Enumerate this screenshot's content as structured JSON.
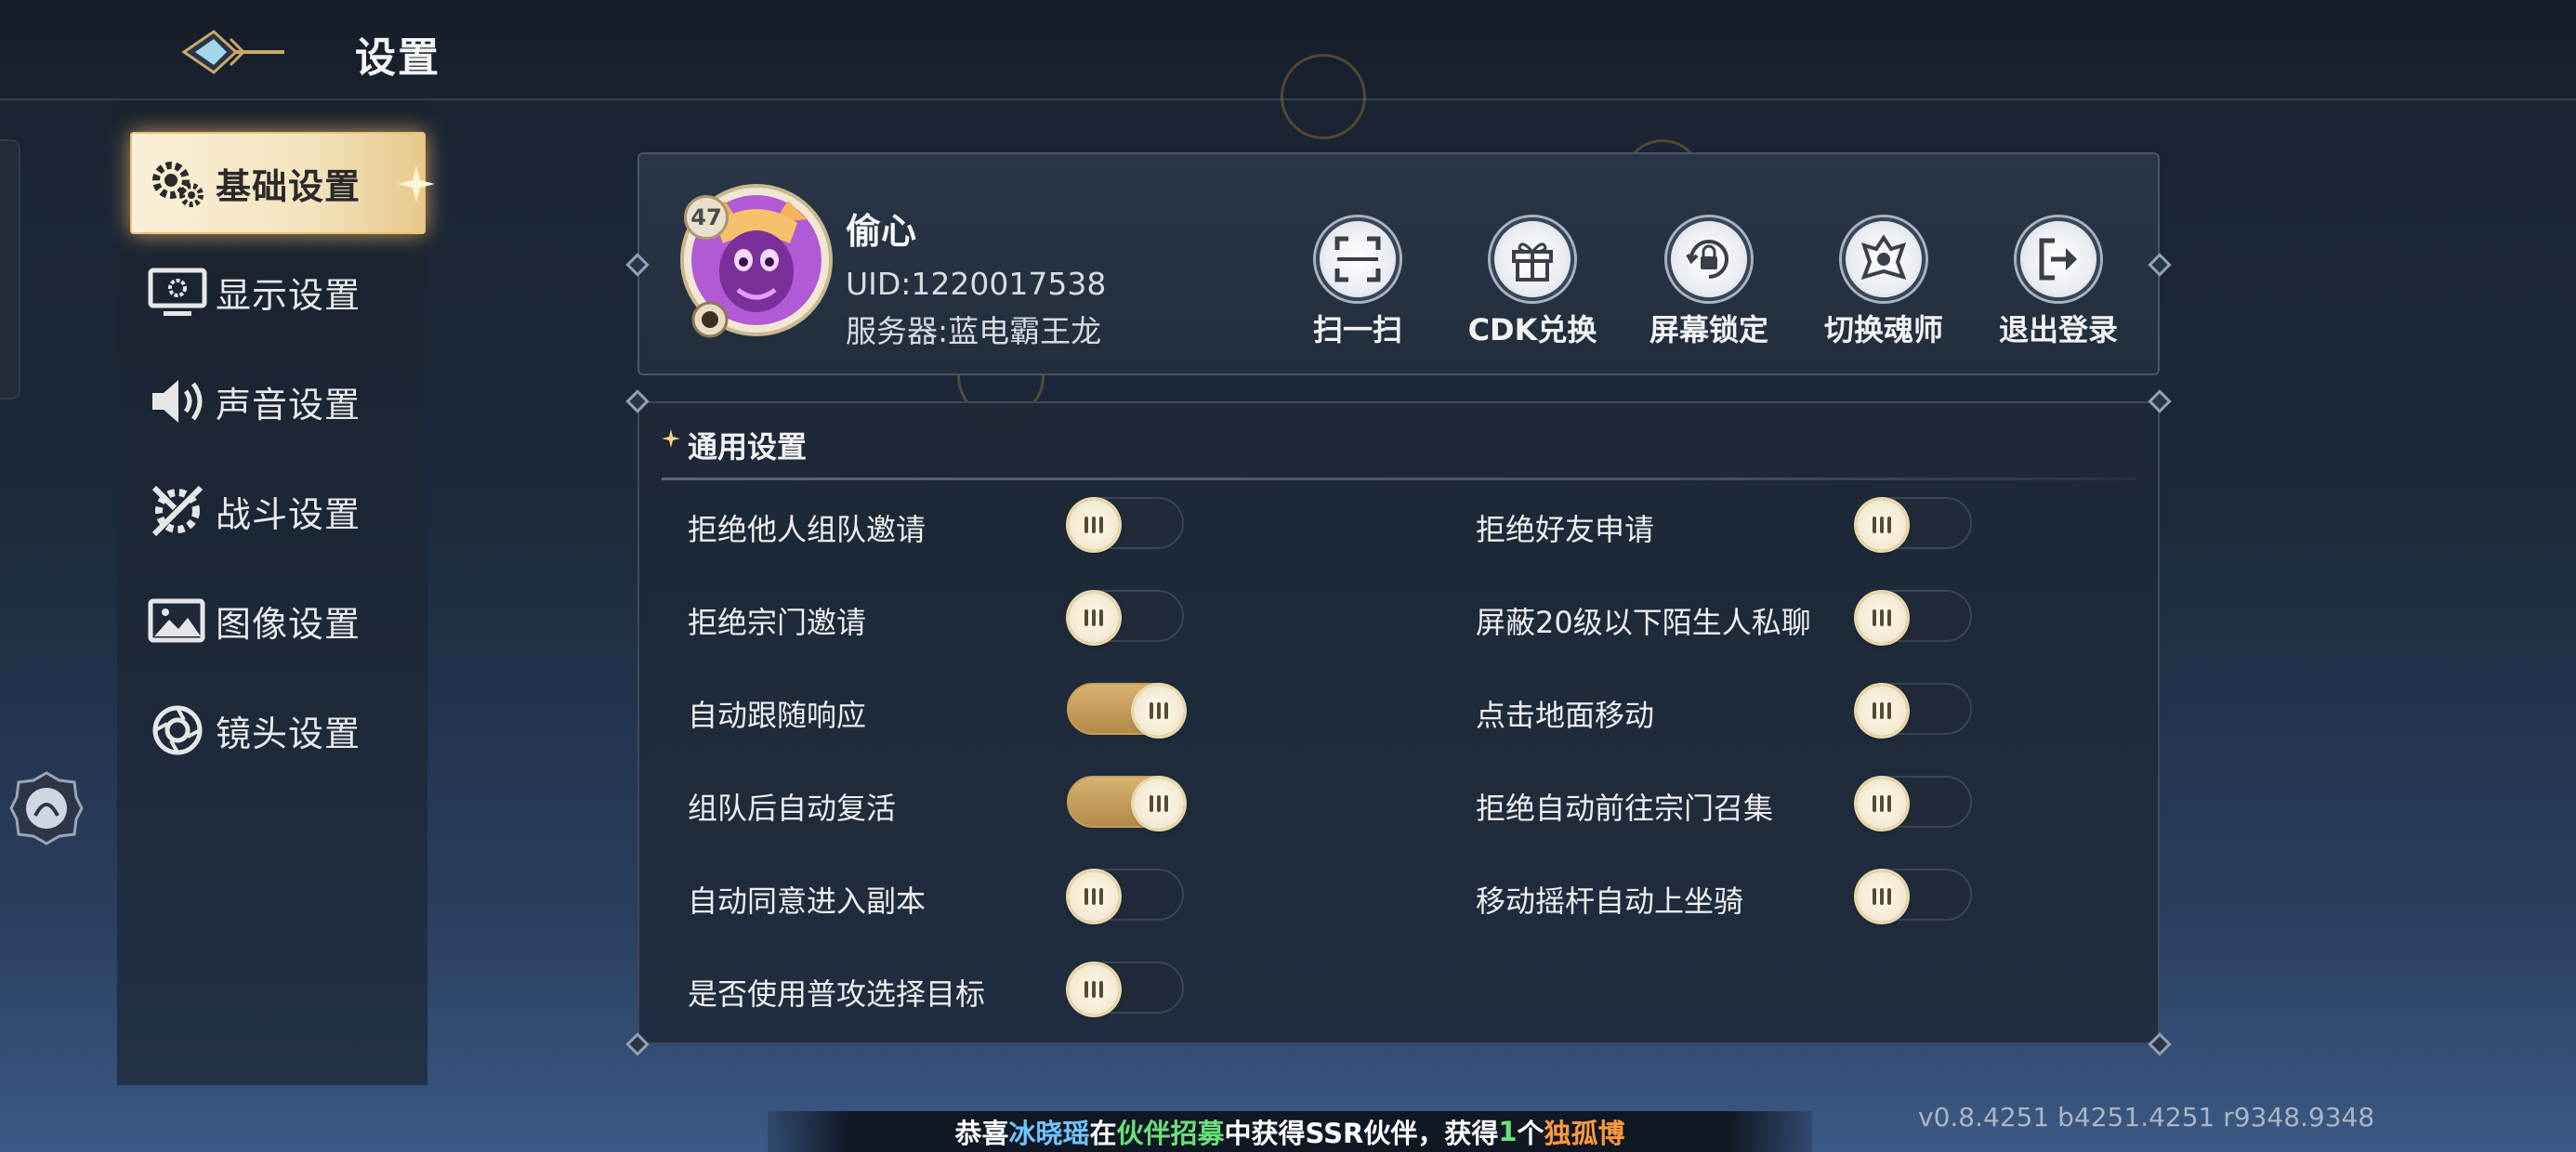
{
  "header": {
    "title": "设置"
  },
  "sidebar": {
    "items": [
      {
        "label": "基础设置",
        "icon": "gear-cog-icon",
        "active": true
      },
      {
        "label": "显示设置",
        "icon": "monitor-icon",
        "active": false
      },
      {
        "label": "声音设置",
        "icon": "speaker-icon",
        "active": false
      },
      {
        "label": "战斗设置",
        "icon": "crossed-swords-icon",
        "active": false
      },
      {
        "label": "图像设置",
        "icon": "image-icon",
        "active": false
      },
      {
        "label": "镜头设置",
        "icon": "camera-lens-icon",
        "active": false
      }
    ]
  },
  "profile": {
    "level": "47",
    "name": "偷心",
    "uid": "UID:1220017538",
    "server": "服务器:蓝电霸王龙",
    "actions": [
      {
        "label": "扫一扫",
        "icon": "scan-icon"
      },
      {
        "label": "CDK兑换",
        "icon": "gift-icon"
      },
      {
        "label": "屏幕锁定",
        "icon": "screen-lock-icon"
      },
      {
        "label": "切换魂师",
        "icon": "switch-character-icon"
      },
      {
        "label": "退出登录",
        "icon": "logout-icon"
      }
    ]
  },
  "general": {
    "title": "通用设置",
    "left_options": [
      {
        "label": "拒绝他人组队邀请",
        "on": false
      },
      {
        "label": "拒绝宗门邀请",
        "on": false
      },
      {
        "label": "自动跟随响应",
        "on": true
      },
      {
        "label": "组队后自动复活",
        "on": true
      },
      {
        "label": "自动同意进入副本",
        "on": false
      },
      {
        "label": "是否使用普攻选择目标",
        "on": false
      }
    ],
    "right_options": [
      {
        "label": "拒绝好友申请",
        "on": false
      },
      {
        "label": "屏蔽20级以下陌生人私聊",
        "on": false
      },
      {
        "label": "点击地面移动",
        "on": false
      },
      {
        "label": "拒绝自动前往宗门召集",
        "on": false
      },
      {
        "label": "移动摇杆自动上坐骑",
        "on": false
      }
    ]
  },
  "broadcast": {
    "p1": "恭喜",
    "player": "冰晓瑶",
    "p2": "在",
    "event": "伙伴招募",
    "p3": "中获得SSR伙伴，获得",
    "count": "1",
    "p4": "个",
    "reward": "独孤博"
  },
  "version": "v0.8.4251 b4251.4251 r9348.9348",
  "colors": {
    "accent_gold": "#d7b272",
    "panel": "#232e3d",
    "active_nav": "#f3e4be"
  }
}
